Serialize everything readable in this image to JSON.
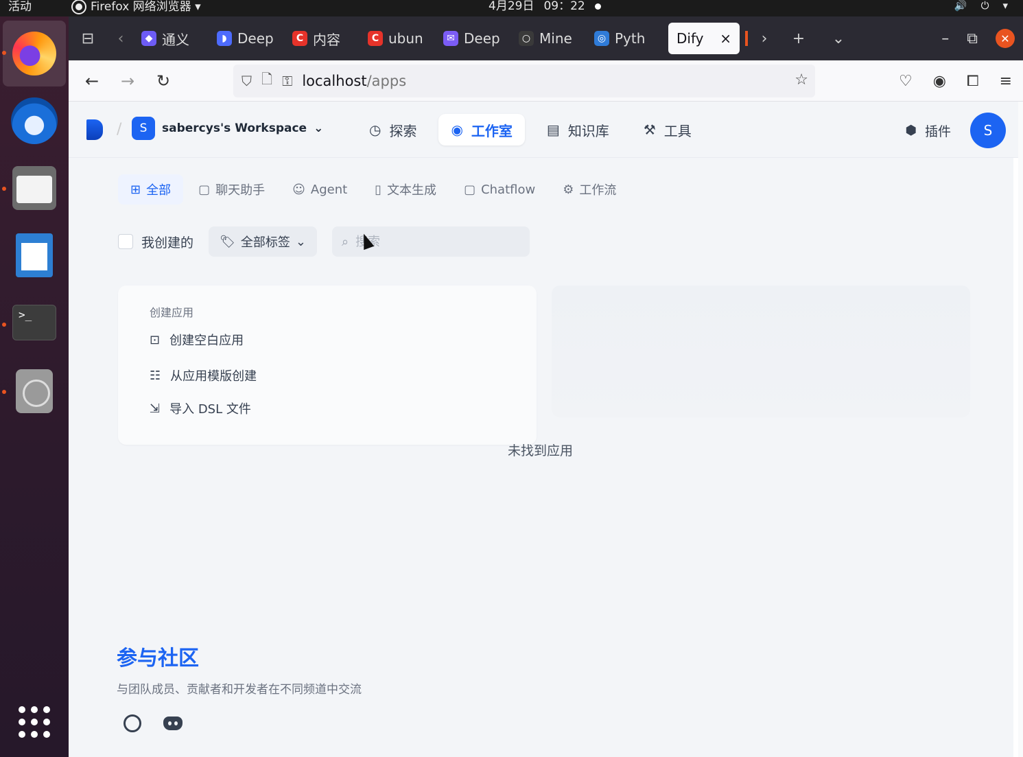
{
  "system_bar": {
    "activities": "活动",
    "app_name": "Firefox 网络浏览器 ▾",
    "date": "4月29日",
    "time": "09：22",
    "tray_volume": "🔊",
    "tray_power": "⏻",
    "tray_menu": "▾"
  },
  "dock": {
    "apps": [
      "firefox",
      "thunderbird",
      "files",
      "libreoffice-writer",
      "terminal",
      "disc"
    ],
    "terminal_glyph": ">_"
  },
  "browser": {
    "tabs": [
      {
        "label": "通义",
        "fav_color": "#6d5cf5",
        "fav_glyph": "◆"
      },
      {
        "label": "Deep",
        "fav_color": "#4d6bfe",
        "fav_glyph": "◗"
      },
      {
        "label": "内容",
        "fav_color": "#e6332a",
        "fav_glyph": "C"
      },
      {
        "label": "ubun",
        "fav_color": "#e6332a",
        "fav_glyph": "C"
      },
      {
        "label": "Deep",
        "fav_color": "#7b5cf5",
        "fav_glyph": "✉"
      },
      {
        "label": "Mine",
        "fav_color": "#3a3a3a",
        "fav_glyph": "○"
      },
      {
        "label": "Pyth",
        "fav_color": "#2f7bd8",
        "fav_glyph": "◎"
      }
    ],
    "active_tab": {
      "label": "Dify",
      "close": "×"
    },
    "url_host": "localhost",
    "url_path": "/apps"
  },
  "dify": {
    "workspace_initial": "S",
    "workspace_name": "sabercys's Workspace",
    "nav": [
      {
        "label": "探索",
        "icon": "compass-icon",
        "glyph": "◷"
      },
      {
        "label": "工作室",
        "icon": "robot-icon",
        "glyph": "◉",
        "active": true
      },
      {
        "label": "知识库",
        "icon": "book-icon",
        "glyph": "▤"
      },
      {
        "label": "工具",
        "icon": "hammer-icon",
        "glyph": "⚒"
      }
    ],
    "plugins_label": "插件",
    "avatar_initial": "S",
    "categories": [
      {
        "label": "全部",
        "glyph": "⊞",
        "active": true
      },
      {
        "label": "聊天助手",
        "glyph": "▢"
      },
      {
        "label": "Agent",
        "glyph": "☺"
      },
      {
        "label": "文本生成",
        "glyph": "▯"
      },
      {
        "label": "Chatflow",
        "glyph": "▢"
      },
      {
        "label": "工作流",
        "glyph": "⚙"
      }
    ],
    "filter_mine": "我创建的",
    "tag_select": "全部标签",
    "search_placeholder": "搜索",
    "create_title": "创建应用",
    "create_options": [
      {
        "label": "创建空白应用",
        "glyph": "⊡"
      },
      {
        "label": "从应用模版创建",
        "glyph": "☷"
      },
      {
        "label": "导入 DSL 文件",
        "glyph": "⇲"
      }
    ],
    "empty_text": "未找到应用",
    "community_title": "参与社区",
    "community_sub": "与团队成员、贡献者和开发者在不同频道中交流"
  }
}
